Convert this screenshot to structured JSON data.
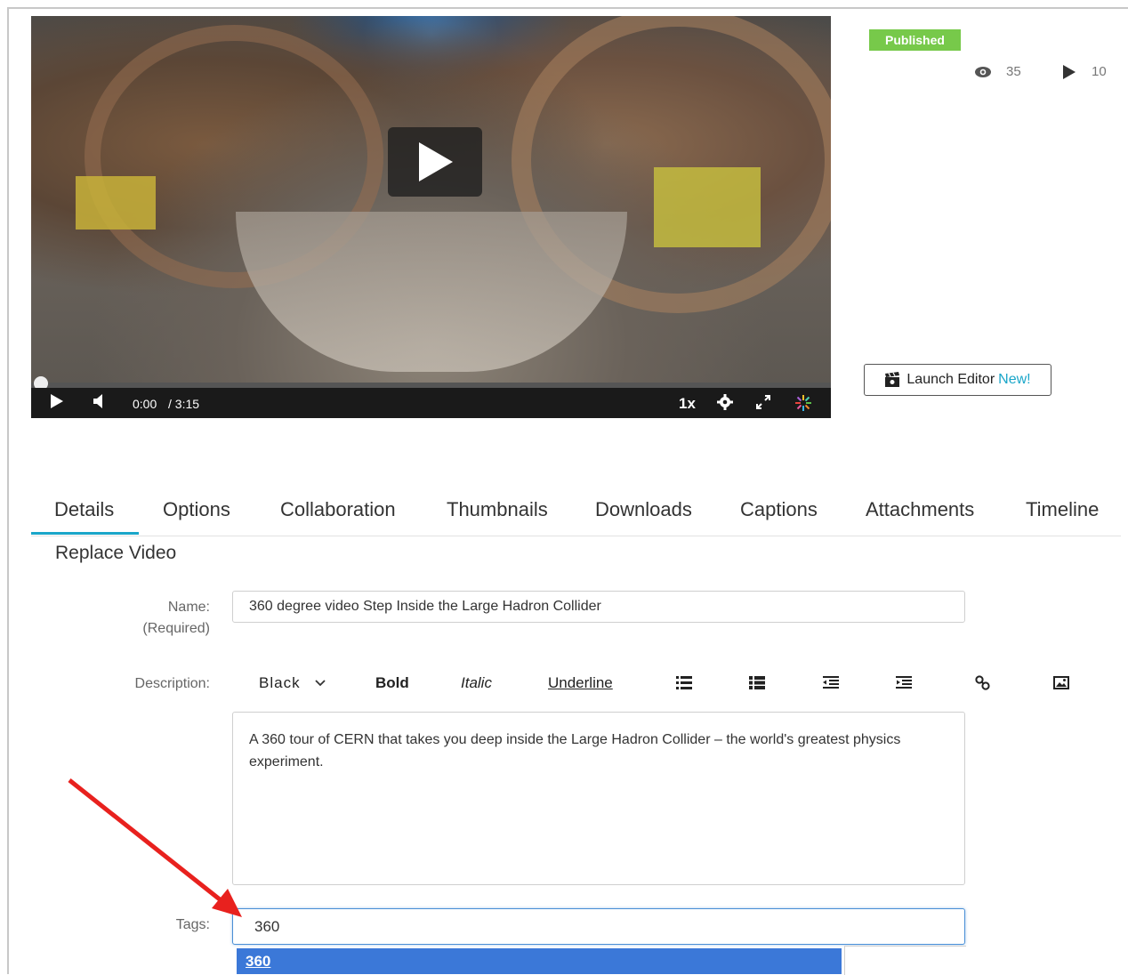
{
  "player": {
    "current_time": "0:00",
    "duration": "/ 3:15",
    "speed": "1x",
    "progress": 0
  },
  "status": {
    "badge": "Published",
    "views": "35",
    "plays": "10"
  },
  "launch_editor": {
    "label": "Launch Editor",
    "new_label": "New!"
  },
  "tabs": [
    "Details",
    "Options",
    "Collaboration",
    "Thumbnails",
    "Downloads",
    "Captions",
    "Attachments",
    "Timeline"
  ],
  "active_tab": "Details",
  "replace_video": "Replace Video",
  "form": {
    "name_label": "Name:",
    "name_required": "(Required)",
    "name_value": "360 degree video Step Inside the Large Hadron Collider",
    "description_label": "Description:",
    "toolbar": {
      "color": "Black",
      "bold": "Bold",
      "italic": "Italic",
      "underline": "Underline"
    },
    "description_value": "A 360 tour of CERN that takes you deep inside the Large Hadron Collider – the world's greatest physics experiment.",
    "tags_label": "Tags:",
    "tags_value": "360",
    "suggestion": "360"
  },
  "colors": {
    "accent": "#1aa6c9",
    "published": "#77c94a",
    "highlight": "#3b78d8",
    "annotation_arrow": "#e8211e"
  }
}
